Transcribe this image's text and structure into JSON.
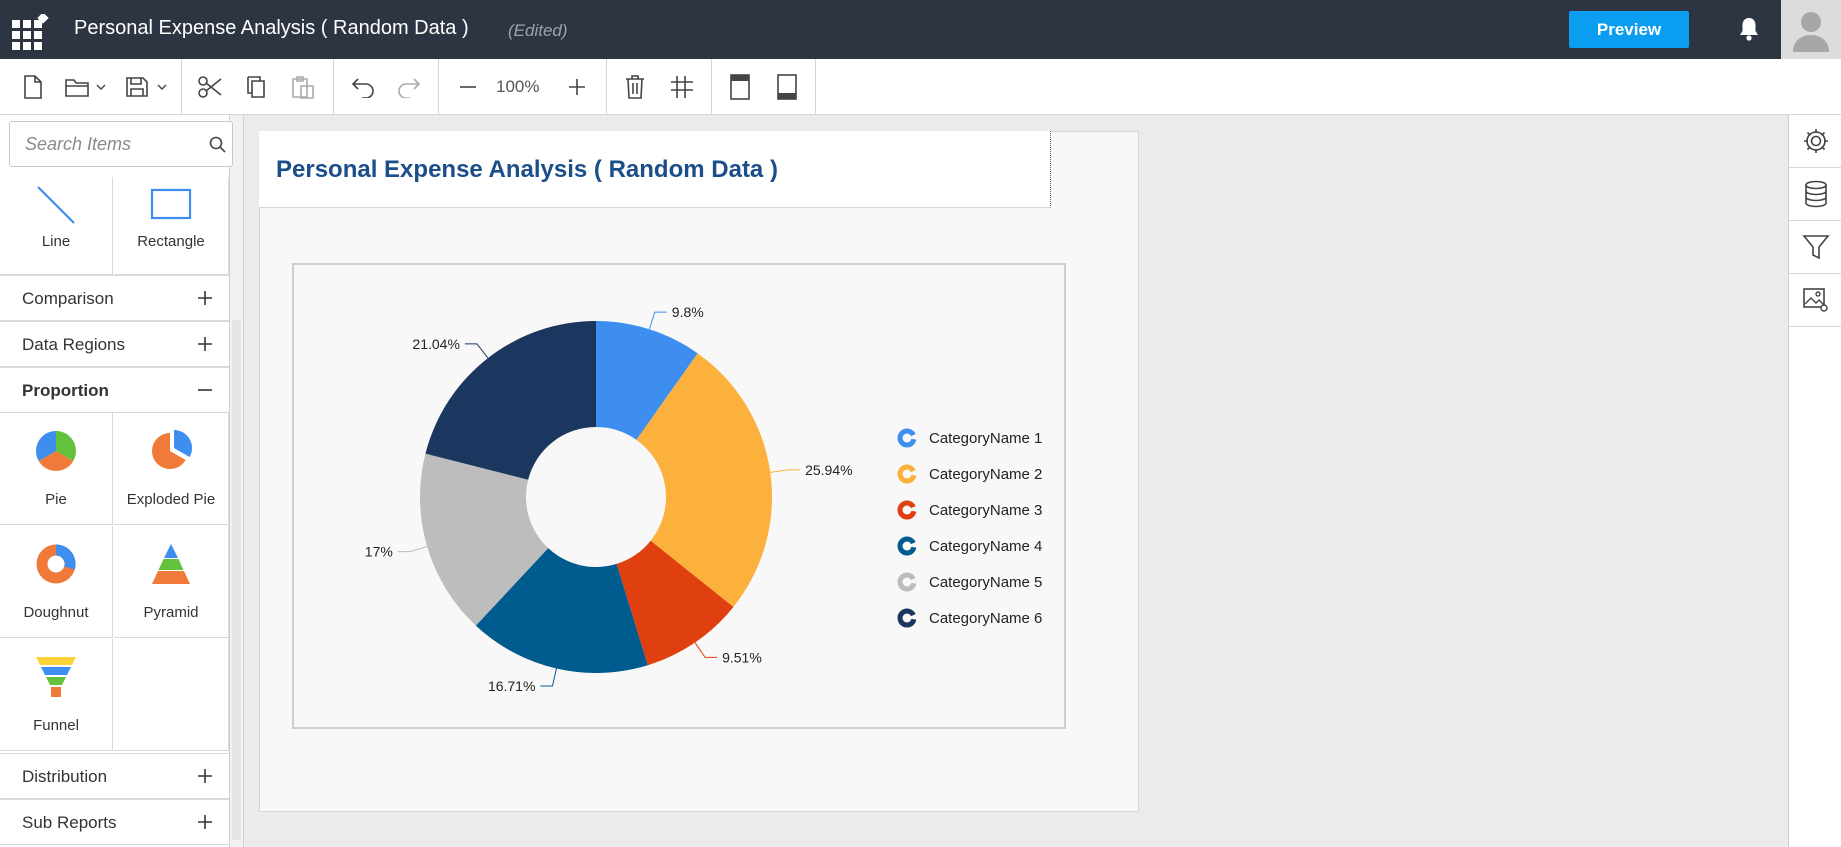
{
  "header": {
    "title": "Personal Expense Analysis ( Random Data )",
    "status": "(Edited)",
    "preview_label": "Preview"
  },
  "toolbar": {
    "zoom": "100%",
    "buttons": [
      "new-file-icon",
      "open-folder-icon",
      "save-icon",
      "cut-icon",
      "copy-icon",
      "paste-icon",
      "undo-icon",
      "redo-icon",
      "zoom-out-icon",
      "zoom-in-icon",
      "delete-icon",
      "grid-icon",
      "header-icon",
      "footer-icon"
    ]
  },
  "left_panel": {
    "search": {
      "placeholder": "Search Items"
    },
    "basic_items": [
      {
        "label": "Line",
        "icon": "line-icon"
      },
      {
        "label": "Rectangle",
        "icon": "rectangle-icon"
      }
    ],
    "groups": {
      "comparison": "Comparison",
      "data_regions": "Data Regions",
      "proportion": "Proportion",
      "distribution": "Distribution",
      "sub_reports": "Sub Reports"
    },
    "proportion_items": [
      {
        "label": "Pie",
        "icon": "pie-chart-icon"
      },
      {
        "label": "Exploded Pie",
        "icon": "exploded-pie-icon"
      },
      {
        "label": "Doughnut",
        "icon": "doughnut-icon"
      },
      {
        "label": "Pyramid",
        "icon": "pyramid-icon"
      },
      {
        "label": "Funnel",
        "icon": "funnel-icon"
      }
    ]
  },
  "report": {
    "title": "Personal Expense Analysis ( Random Data )"
  },
  "right_panel": [
    "settings-icon",
    "database-icon",
    "filter-icon",
    "image-settings-icon"
  ],
  "colors": {
    "header_bg": "#2d3543",
    "accent": "#0b9ef0",
    "title_text": "#1c4e8a"
  },
  "chart_data": {
    "type": "pie",
    "subtype": "doughnut",
    "categories": [
      "CategoryName 1",
      "CategoryName 2",
      "CategoryName 3",
      "CategoryName 4",
      "CategoryName 5",
      "CategoryName 6"
    ],
    "values": [
      9.8,
      25.94,
      9.51,
      16.71,
      17,
      21.04
    ],
    "labels": [
      "9.8%",
      "25.94%",
      "9.51%",
      "16.71%",
      "17%",
      "21.04%"
    ],
    "colors": [
      "#3e8ef0",
      "#fbb13c",
      "#e0400f",
      "#005b8f",
      "#bdbdbd",
      "#1b365f"
    ],
    "legend_position": "right"
  }
}
